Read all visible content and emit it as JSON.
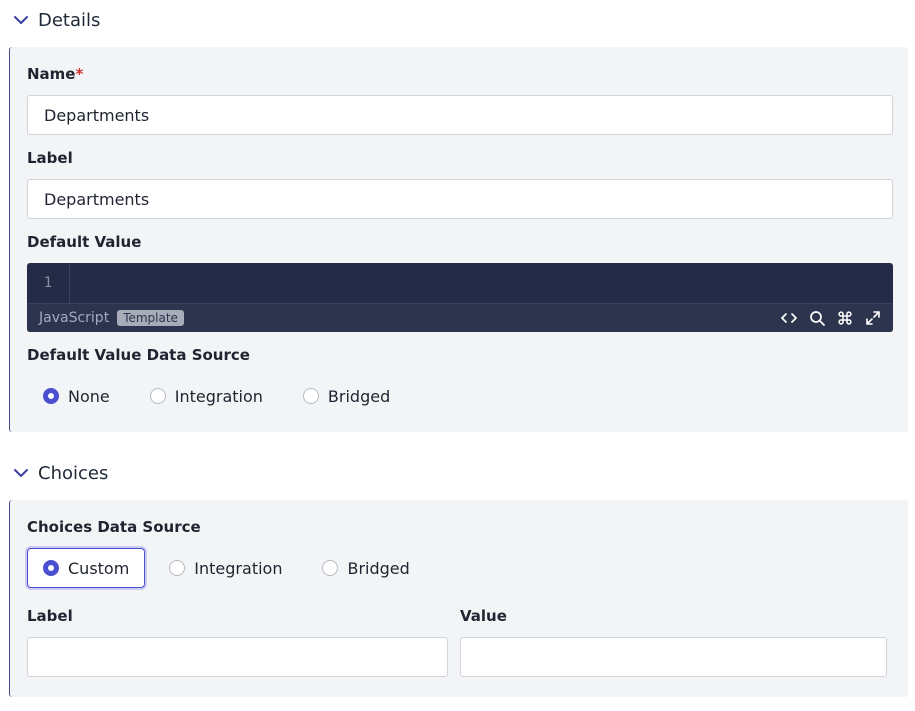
{
  "details": {
    "title": "Details",
    "name_label": "Name",
    "name_required": "*",
    "name_value": "Departments",
    "label_label": "Label",
    "label_value": "Departments",
    "default_value_label": "Default Value",
    "editor": {
      "line_number": "1",
      "language": "JavaScript",
      "badge": "Template",
      "tools": [
        "code-icon",
        "search-icon",
        "command-icon",
        "expand-icon"
      ]
    },
    "data_source_label": "Default Value Data Source",
    "data_source_options": [
      "None",
      "Integration",
      "Bridged"
    ],
    "data_source_selected": "None"
  },
  "choices": {
    "title": "Choices",
    "data_source_label": "Choices Data Source",
    "data_source_options": [
      "Custom",
      "Integration",
      "Bridged"
    ],
    "data_source_selected": "Custom",
    "label_col": "Label",
    "value_col": "Value",
    "label_value": "",
    "value_value": ""
  },
  "colors": {
    "accent": "#4a4fcf",
    "editor_bg": "#232b47",
    "panel_bg": "#f3f4f6",
    "required": "#d0312d"
  }
}
